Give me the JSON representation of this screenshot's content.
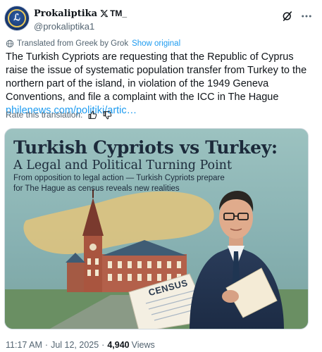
{
  "post": {
    "author": {
      "display_name": "Prokaliptika",
      "name_suffix": "TM_",
      "handle": "@prokaliptika1"
    },
    "translation": {
      "notice": "Translated from Greek by Grok",
      "show_original": "Show original"
    },
    "text": "The Turkish Cypriots are requesting that the Republic of Cyprus raise the issue of systematic population transfer from Turkey to the northern part of the island, in violation of the 1949 Geneva Conventions, and file a complaint with the ICC in The Hague ",
    "link_text": "philenews.com/politiki/artic…",
    "rate_label": "Rate this translation:",
    "media": {
      "headline": "Turkish Cypriots vs Turkey:",
      "subheadline": "A Legal and Political Turning Point",
      "kicker": "From opposition to legal action — Turkish Cypriots prepare for The Hague as census reveals new realities",
      "census_text": "CENSUS"
    },
    "meta": {
      "time": "11:17 AM",
      "separator": "·",
      "date": "Jul 12, 2025",
      "views": "4,940",
      "views_label": "Views"
    }
  },
  "icons": {
    "avatar_mark": "ℒ",
    "x_logo": "x-logo-icon",
    "grok": "grok-icon",
    "more": "more-icon",
    "globe": "globe-icon",
    "thumbs_up": "thumbs-up-icon",
    "thumbs_down": "thumbs-down-icon"
  },
  "colors": {
    "link": "#1d9bf0",
    "secondary_text": "#536471",
    "primary_text": "#0f1419"
  }
}
